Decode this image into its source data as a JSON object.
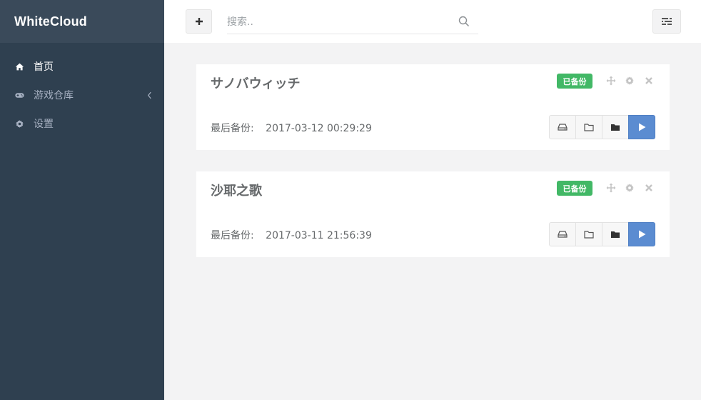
{
  "app": {
    "brand": "WhiteCloud"
  },
  "sidebar": {
    "items": [
      {
        "label": "首页",
        "icon": "home-icon",
        "active": true
      },
      {
        "label": "游戏仓库",
        "icon": "gamepad-icon",
        "has_submenu": true
      },
      {
        "label": "设置",
        "icon": "gear-icon"
      }
    ]
  },
  "topbar": {
    "add_label": "+",
    "search": {
      "placeholder": "搜索..",
      "value": ""
    }
  },
  "cards": [
    {
      "title": "サノバウィッチ",
      "badge": "已备份",
      "backup_label": "最后备份:",
      "backup_time": "2017-03-12 00:29:29"
    },
    {
      "title": "沙耶之歌",
      "badge": "已备份",
      "backup_label": "最后备份:",
      "backup_time": "2017-03-11 21:56:39"
    }
  ],
  "colors": {
    "sidebar_bg": "#2f4050",
    "brand_bg": "#3a4a5a",
    "badge_green": "#42b866",
    "play_blue": "#5b8cd1",
    "page_bg": "#f3f3f4"
  }
}
